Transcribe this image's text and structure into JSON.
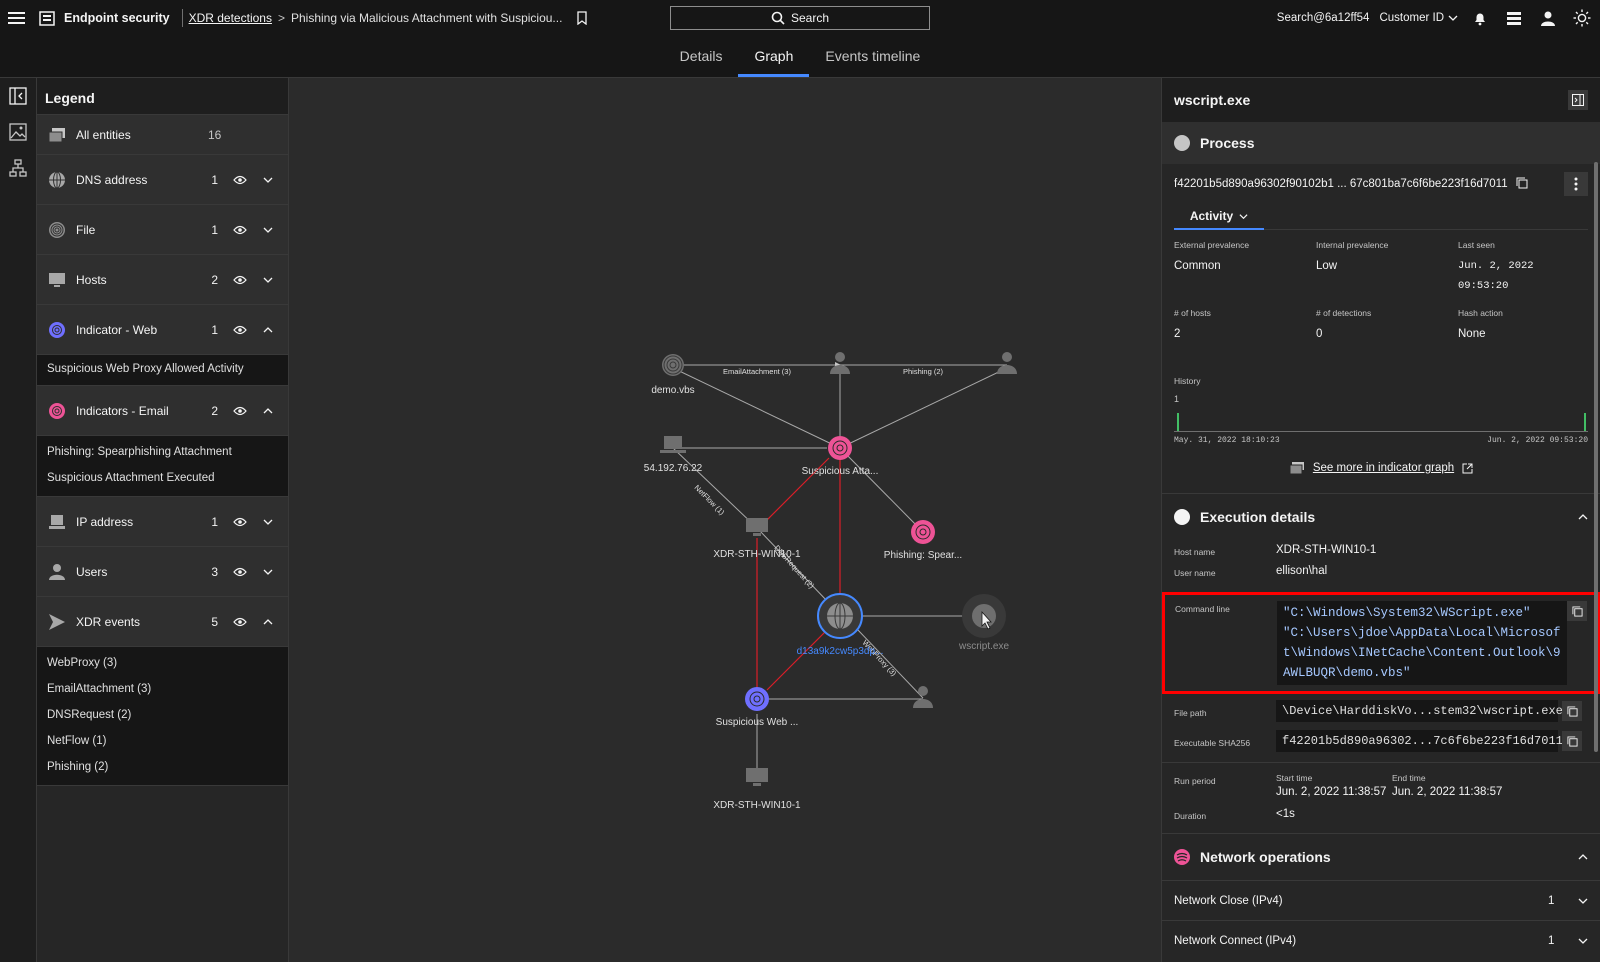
{
  "topbar": {
    "product": "Endpoint security",
    "breadcrumb_link": "XDR detections",
    "breadcrumb_separator": ">",
    "breadcrumb_current": "Phishing via Malicious Attachment with Suspiciou...",
    "search_label": "Search",
    "user": "Search@6a12ff54",
    "customer": "Customer ID"
  },
  "tabs": [
    "Details",
    "Graph",
    "Events timeline"
  ],
  "legend": {
    "title": "Legend",
    "all": {
      "label": "All entities",
      "count": "16"
    },
    "rows": [
      {
        "label": "DNS address",
        "count": "1",
        "icon": "globe-icon",
        "expanded": false
      },
      {
        "label": "File",
        "count": "1",
        "icon": "fingerprint-icon",
        "expanded": false
      },
      {
        "label": "Hosts",
        "count": "2",
        "icon": "monitor-icon",
        "expanded": false
      },
      {
        "label": "Indicator - Web",
        "count": "1",
        "icon": "indicator-web-icon",
        "expanded": true,
        "items": [
          "Suspicious Web Proxy Allowed Activity"
        ]
      },
      {
        "label": "Indicators - Email",
        "count": "2",
        "icon": "indicator-email-icon",
        "expanded": true,
        "items": [
          "Phishing: Spearphishing Attachment",
          "Suspicious Attachment Executed"
        ]
      },
      {
        "label": "IP address",
        "count": "1",
        "icon": "laptop-icon",
        "expanded": false
      },
      {
        "label": "Users",
        "count": "3",
        "icon": "user-icon",
        "expanded": false
      },
      {
        "label": "XDR events",
        "count": "5",
        "icon": "xdr-icon",
        "expanded": true,
        "items": [
          "WebProxy (3)",
          "EmailAttachment (3)",
          "DNSRequest (2)",
          "NetFlow (1)",
          "Phishing (2)"
        ]
      }
    ]
  },
  "graph": {
    "nodes": {
      "demo": "demo.vbs",
      "ip": "54.192.76.22",
      "susp_att": "Suspicious Atta...",
      "host1": "XDR-STH-WIN10-1",
      "phish": "Phishing: Spear...",
      "dns": "d13a9k2cw5p3dp...",
      "wscript": "wscript.exe",
      "susp_web": "Suspicious Web ...",
      "host2": "XDR-STH-WIN10-1"
    },
    "edges": {
      "email_attachment": "EmailAttachment (3)",
      "phishing": "Phishing (2)",
      "netflow": "NetFlow (1)",
      "dns_request": "DNSRequest (2)",
      "web_proxy": "WebProxy (3)"
    }
  },
  "panel": {
    "title": "wscript.exe",
    "process": {
      "heading": "Process",
      "hash": "f42201b5d890a96302f90102b1 ... 67c801ba7c6f6be223f16d7011",
      "activity_tab": "Activity",
      "fields": [
        {
          "label": "External prevalence",
          "value": "Common"
        },
        {
          "label": "Internal prevalence",
          "value": "Low"
        },
        {
          "label": "Last seen",
          "value": "Jun. 2, 2022 09:53:20"
        },
        {
          "label": "# of hosts",
          "value": "2"
        },
        {
          "label": "# of detections",
          "value": "0"
        },
        {
          "label": "Hash action",
          "value": "None"
        }
      ],
      "history_label": "History",
      "history_count": "1",
      "history_start": "May. 31, 2022 18:10:23",
      "history_end": "Jun. 2, 2022 09:53:20",
      "see_more": "See more in indicator graph"
    },
    "execution": {
      "heading": "Execution details",
      "host_name_label": "Host name",
      "host_name": "XDR-STH-WIN10-1",
      "user_name_label": "User name",
      "user_name": "ellison\\hal",
      "command_line_label": "Command line",
      "command_line": "\"C:\\Windows\\System32\\WScript.exe\" \"C:\\Users\\jdoe\\AppData\\Local\\Microsoft\\Windows\\INetCache\\Content.Outlook\\9AWLBUQR\\demo.vbs\"",
      "file_path_label": "File path",
      "file_path": "\\Device\\HarddiskVo...stem32\\wscript.exe",
      "sha_label": "Executable SHA256",
      "sha": "f42201b5d890a96302...7c6f6be223f16d7011",
      "run_period_label": "Run period",
      "start_label": "Start time",
      "start": "Jun. 2, 2022 11:38:57",
      "end_label": "End time",
      "end": "Jun. 2, 2022 11:38:57",
      "duration_label": "Duration",
      "duration": "<1s"
    },
    "network": {
      "heading": "Network operations",
      "rows": [
        {
          "label": "Network Close (IPv4)",
          "count": "1"
        },
        {
          "label": "Network Connect (IPv4)",
          "count": "1"
        }
      ]
    }
  },
  "colors": {
    "accent": "#4589ff",
    "indicator_email": "#ee5396",
    "indicator_web": "#6f6fff",
    "edge_red": "#da1e28",
    "highlight": "#ff0000"
  }
}
